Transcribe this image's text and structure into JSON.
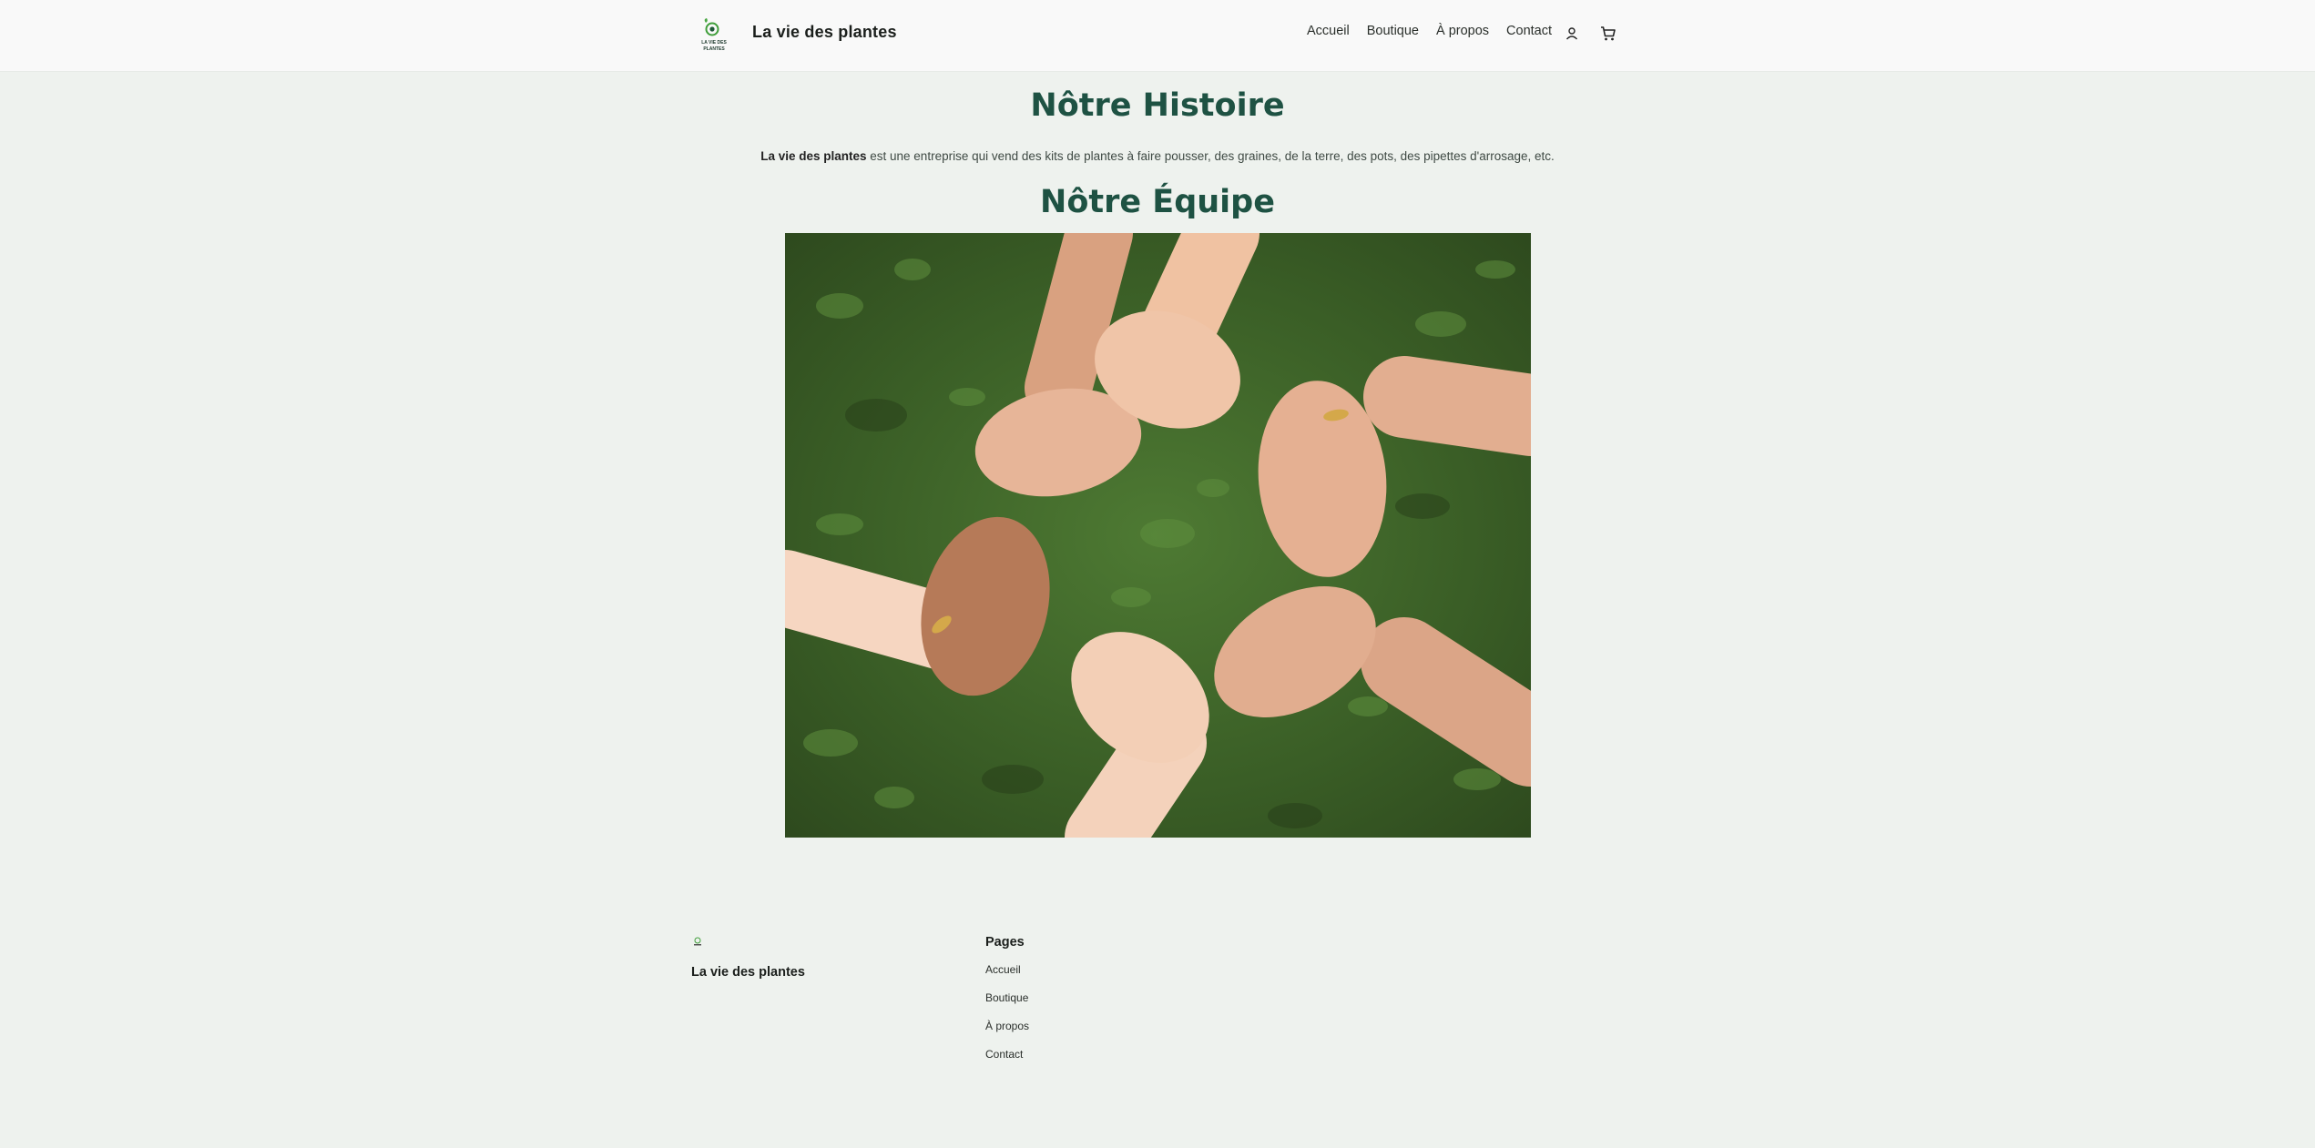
{
  "header": {
    "brand": "La vie des plantes",
    "logo_text_line1": "LA VIE DES",
    "logo_text_line2": "PLANTES",
    "nav": [
      "Accueil",
      "Boutique",
      "À propos",
      "Contact"
    ],
    "icons": [
      "user-icon",
      "cart-icon"
    ]
  },
  "main": {
    "histoire_title": "Nôtre Histoire",
    "intro_strong": "La vie des plantes",
    "intro_rest": " est une entreprise qui vend des kits de plantes à faire pousser, des graines, de la terre, des pots, des pipettes d'arrosage, etc.",
    "equipe_title": "Nôtre Équipe"
  },
  "footer": {
    "brand": "La vie des plantes",
    "pages_title": "Pages",
    "links": [
      "Accueil",
      "Boutique",
      "À propos",
      "Contact"
    ]
  },
  "colors": {
    "background": "#eef2ee",
    "header_bg": "#f9f9f9",
    "heading": "#1e5243",
    "logo_green": "#3f9e3a"
  }
}
